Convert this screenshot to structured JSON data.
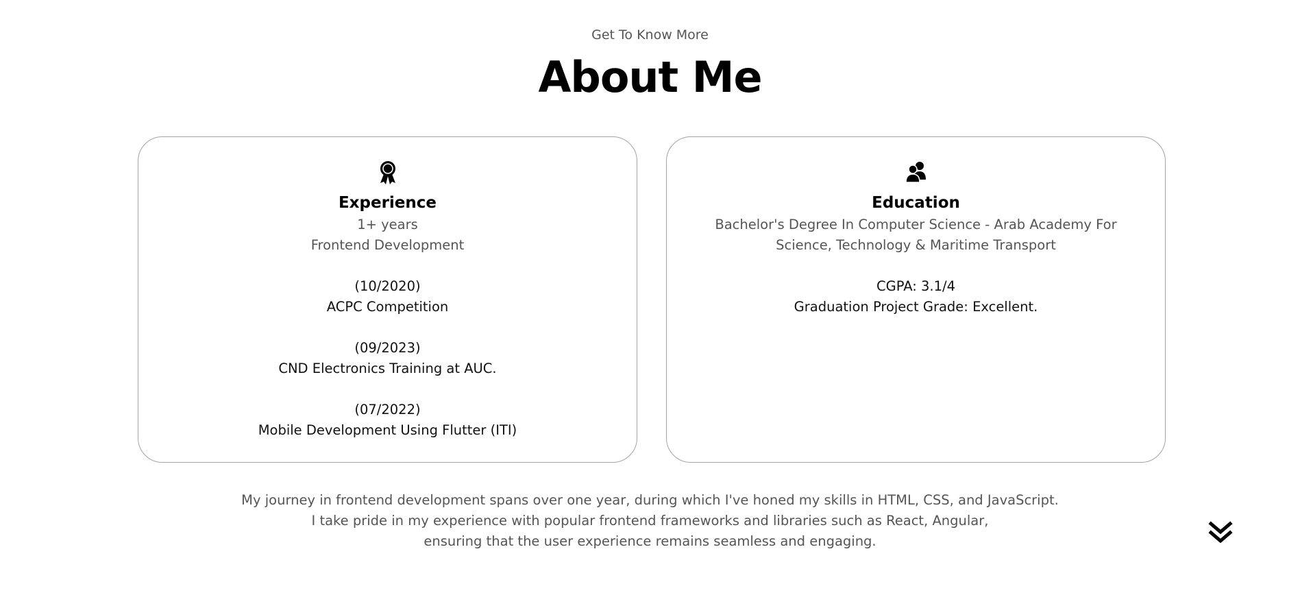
{
  "header": {
    "subtitle": "Get To Know More",
    "title": "About Me"
  },
  "experience": {
    "icon": "award-icon",
    "title": "Experience",
    "summary_line1": "1+ years",
    "summary_line2": "Frontend Development",
    "items": [
      {
        "date": "(10/2020)",
        "label": "ACPC Competition"
      },
      {
        "date": "(09/2023)",
        "label": "CND Electronics Training at AUC."
      },
      {
        "date": "(07/2022)",
        "label": "Mobile Development Using Flutter (ITI)"
      }
    ]
  },
  "education": {
    "icon": "users-icon",
    "title": "Education",
    "degree_line1": "Bachelor's Degree In Computer Science - Arab Academy For",
    "degree_line2": "Science, Technology & Maritime Transport",
    "cgpa": "CGPA: 3.1/4",
    "project_grade": "Graduation Project Grade: Excellent."
  },
  "paragraph": {
    "line1": "My journey in frontend development spans over one year, during which I've honed my skills in HTML, CSS, and JavaScript.",
    "line2": "I take pride in my experience with popular frontend frameworks and libraries such as React, Angular,",
    "line3": "ensuring that the user experience remains seamless and engaging."
  },
  "scroll_arrow": {
    "icon": "double-chevron-down-icon"
  }
}
